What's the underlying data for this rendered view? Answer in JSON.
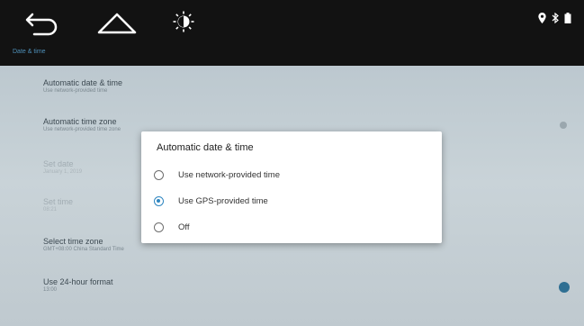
{
  "breadcrumb": "Date & time",
  "settings": [
    {
      "title": "Automatic date & time",
      "subtitle": "Use network-provided time"
    },
    {
      "title": "Automatic time zone",
      "subtitle": "Use network-provided time zone"
    },
    {
      "title": "Set date",
      "subtitle": "January 1, 2019"
    },
    {
      "title": "Set time",
      "subtitle": "08:21"
    },
    {
      "title": "Select time zone",
      "subtitle": "GMT+08:00 China Standard Time"
    },
    {
      "title": "Use 24-hour format",
      "subtitle": "13:00"
    }
  ],
  "dialog": {
    "title": "Automatic date & time",
    "options": [
      {
        "label": "Use network-provided time",
        "selected": false
      },
      {
        "label": "Use GPS-provided time",
        "selected": true
      },
      {
        "label": "Off",
        "selected": false
      }
    ]
  },
  "icons": {
    "back": "back-arrow-icon",
    "home": "home-icon",
    "brightness": "brightness-icon",
    "location": "location-icon",
    "bluetooth": "bluetooth-icon",
    "battery": "battery-icon"
  },
  "colors": {
    "accent": "#2f86c0",
    "topbar": "#121212",
    "toggle_on": "#2f6f93"
  }
}
